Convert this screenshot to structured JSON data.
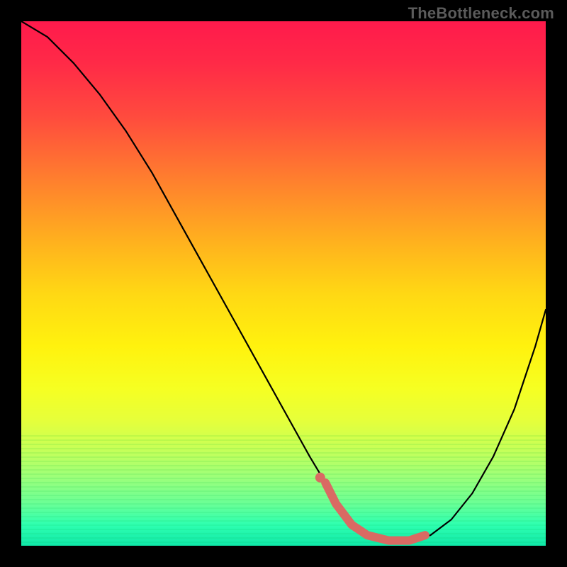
{
  "watermark": {
    "text": "TheBottleneck.com"
  },
  "chart_data": {
    "type": "line",
    "title": "",
    "xlabel": "",
    "ylabel": "",
    "xlim": [
      0,
      100
    ],
    "ylim": [
      0,
      100
    ],
    "series": [
      {
        "name": "bottleneck-curve",
        "x": [
          0,
          5,
          10,
          15,
          20,
          25,
          30,
          35,
          40,
          45,
          50,
          55,
          58,
          60,
          63,
          66,
          70,
          74,
          78,
          82,
          86,
          90,
          94,
          98,
          100
        ],
        "values": [
          100,
          97,
          92,
          86,
          79,
          71,
          62,
          53,
          44,
          35,
          26,
          17,
          12,
          8,
          4,
          2,
          1,
          1,
          2,
          5,
          10,
          17,
          26,
          38,
          45
        ]
      }
    ],
    "highlight": {
      "name": "optimal-range",
      "x": [
        58,
        60,
        63,
        66,
        70,
        74,
        77
      ],
      "values": [
        12,
        8,
        4,
        2,
        1,
        1,
        2
      ]
    },
    "background": {
      "type": "vertical-gradient",
      "stops": [
        {
          "pos": 0.0,
          "color": "#ff1a4c"
        },
        {
          "pos": 0.3,
          "color": "#ff7e2e"
        },
        {
          "pos": 0.62,
          "color": "#fff20e"
        },
        {
          "pos": 0.87,
          "color": "#9cff7a"
        },
        {
          "pos": 1.0,
          "color": "#10e8a8"
        }
      ]
    }
  }
}
